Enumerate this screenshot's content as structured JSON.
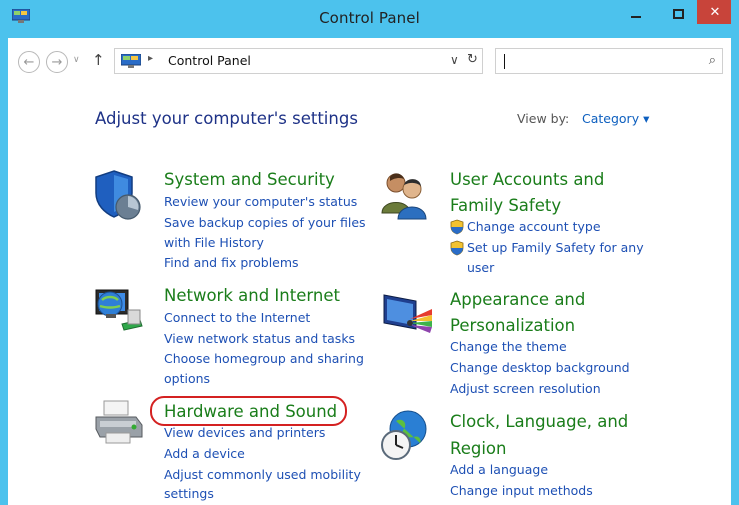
{
  "window": {
    "title": "Control Panel",
    "close_glyph": "✕"
  },
  "address": {
    "back_glyph": "←",
    "forward_glyph": "→",
    "up_glyph": "↑",
    "dropdown_glyph": "∨",
    "refresh_glyph": "↻",
    "search_glyph": "⌕",
    "path_separator": "▸",
    "path": "Control Panel",
    "search_placeholder": ""
  },
  "main": {
    "heading": "Adjust your computer's settings",
    "view_by_label": "View by:",
    "view_by_value": "Category ▾"
  },
  "categories": {
    "system": {
      "title": "System and Security",
      "links": [
        "Review your computer's status",
        "Save backup copies of your files",
        "with File History",
        "Find and fix problems"
      ]
    },
    "network": {
      "title": "Network and Internet",
      "links": [
        "Connect to the Internet",
        "View network status and tasks",
        "Choose homegroup and sharing",
        "options"
      ]
    },
    "hardware": {
      "title": "Hardware and Sound",
      "links": [
        "View devices and printers",
        "Add a device",
        "Adjust commonly used mobility",
        "settings"
      ]
    },
    "users": {
      "title_line1": "User Accounts and",
      "title_line2": "Family Safety",
      "links": [
        "Change account type",
        "Set up Family Safety for any",
        "user"
      ]
    },
    "appearance": {
      "title_line1": "Appearance and",
      "title_line2": "Personalization",
      "links": [
        "Change the theme",
        "Change desktop background",
        "Adjust screen resolution"
      ]
    },
    "clock": {
      "title_line1": "Clock, Language, and",
      "title_line2": "Region",
      "links": [
        "Add a language",
        "Change input methods"
      ]
    }
  },
  "colors": {
    "title_bar": "#4cc2ed",
    "category_title": "#1a7d1a",
    "link": "#1e50b4",
    "heading": "#1e3287",
    "highlight": "#d42121"
  }
}
